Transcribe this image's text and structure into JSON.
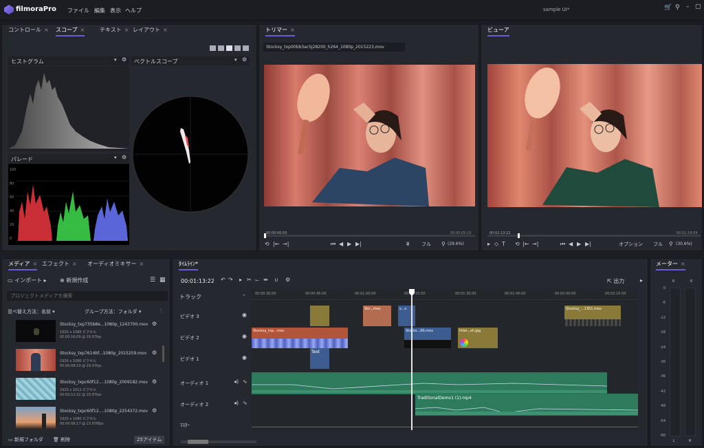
{
  "menubar": {
    "logo_text": "filmoraPro",
    "menus": [
      "ファイル",
      "編集",
      "表示",
      "ヘルプ"
    ],
    "project_title": "sample UI*",
    "window_icons": [
      "cart-icon",
      "user-icon",
      "minimize-icon",
      "restore-icon"
    ]
  },
  "scope_panel": {
    "tabs": [
      "コントロール",
      "スコープ",
      "テキスト",
      "レイアウト"
    ],
    "active_tab": "スコープ",
    "histogram_label": "ヒストグラム",
    "vectorscope_label": "ベクトルスコープ",
    "parade_label": "パレード",
    "parade_scale": [
      "100",
      "80",
      "60",
      "40",
      "20",
      "0"
    ]
  },
  "trimmer": {
    "tab_label": "トリマー",
    "clip_name": "Stocksy_txp00bb3ac5J28200_h264_1080p_2015223.mov",
    "time_start": "00:00:00:00",
    "time_end": "00:00:05:10",
    "quality": "フル",
    "zoom": "(29.6%)"
  },
  "viewer": {
    "tab_label": "ビューア",
    "time_start": "00:01:13:22",
    "time_end": "00:01:18:09",
    "options_label": "オプション",
    "quality": "フル",
    "zoom": "(30.6%)"
  },
  "media_panel": {
    "tabs": [
      "メディア",
      "エフェクト",
      "オーディオミキサー"
    ],
    "active_tab": "メディア",
    "import_label": "インポート",
    "new_label": "新規作成",
    "search_placeholder": "プロジェクトメディアを検索",
    "sort_label": "並べ替え方法：名前",
    "group_label": "グループ方法：フォルダ",
    "items": [
      {
        "name": "Stocksy_txp735b8e...1080p_1243700.mov",
        "res": "1920 x 1080 ピクセル",
        "dur": "00:00:16;09 @ 29.97fps"
      },
      {
        "name": "Stocksy_txp7614bf...1080p_2015259.mov",
        "res": "1920 x 1080 ピクセル",
        "dur": "00:00:08;19 @ 29.97fps"
      },
      {
        "name": "Stocksy_txpc60f12....1080p_2009182.mov",
        "res": "1920 x 1012 ピクセル",
        "dur": "00:00:12;22 @ 29.97fps"
      },
      {
        "name": "Stocksy_txpc60f12....1080p_2254372.mov",
        "res": "1920 x 1080 ピクセル",
        "dur": "00:00:08;17 @ 23.976fps"
      }
    ],
    "new_folder_label": "新規フォルダ",
    "delete_label": "削除",
    "item_count": "25アイテム"
  },
  "timeline": {
    "tab_label": "ﾀｲﾑﾗｲﾝ*",
    "timecode": "00:01:13:22",
    "export_label": "出力",
    "track_header": "トラック",
    "ruler": [
      "00:00:30:00",
      "00:00:45:00",
      "00:01:00:00",
      "00:01:15:00",
      "00:01:30:00",
      "00:01:45:00",
      "00:02:00:00",
      "00:02:15:00"
    ],
    "tracks": [
      "ビデオ 3",
      "ビデオ 2",
      "ビデオ 1",
      "オーディオ 1",
      "オーディオ 2",
      "ﾏｽﾀｰ"
    ],
    "clips": {
      "v3a": "Sto...mov",
      "v3b": "s...v",
      "v3c": "Stocksy_...1351.mov",
      "v2a": "Stocksy_txp...mov",
      "v2b": "Stocks...00.mov",
      "v2c": "Inter...sh.jpg",
      "v1a": "Text",
      "a2": "TraditionalDemo1 (1).mp4"
    }
  },
  "meter": {
    "tab_label": "メーター",
    "top_labels": [
      "0",
      "0"
    ],
    "scale": [
      "0",
      "-6",
      "-12",
      "-18",
      "-24",
      "-30",
      "-36",
      "-42",
      "-48",
      "-54",
      "-60"
    ],
    "bottom_labels": [
      "L",
      "R"
    ]
  },
  "colors": {
    "accent": "#6c5bd4",
    "audio_clip": "#2d7a5d",
    "video_clip_blue": "#3d5c8f",
    "video_clip_gold": "#8a7a3a",
    "video_clip_orange": "#b0553a"
  }
}
